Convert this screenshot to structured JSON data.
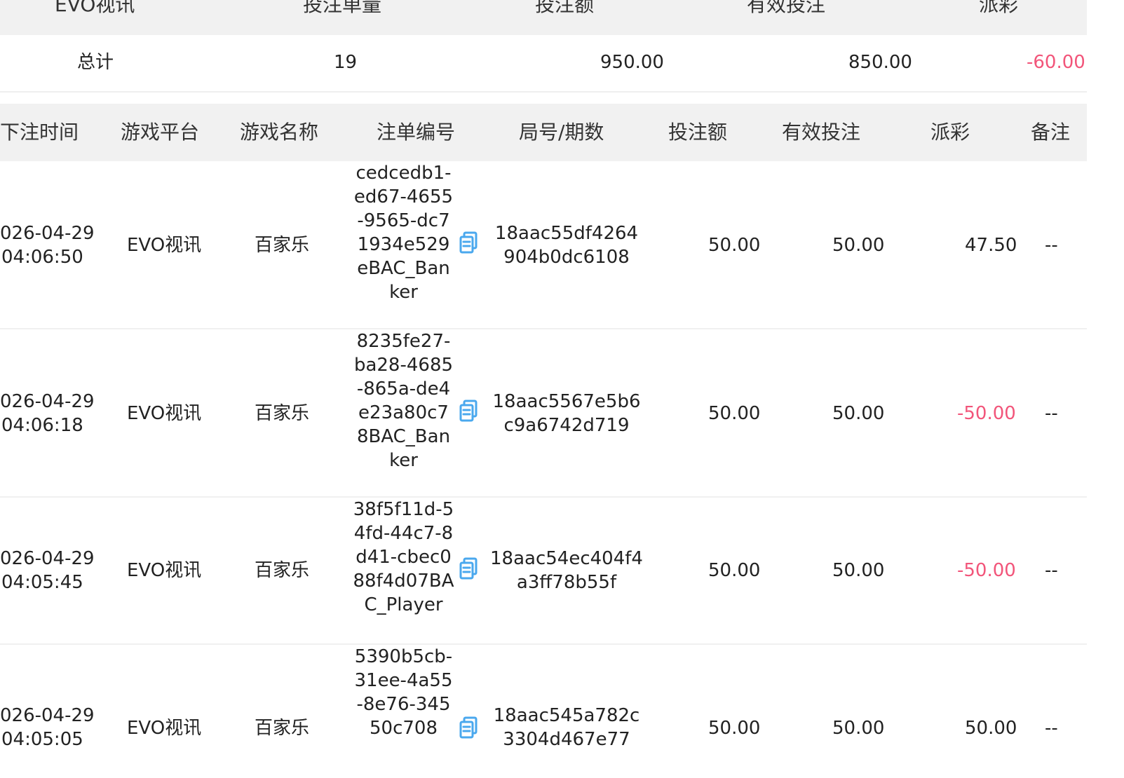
{
  "summary": {
    "headers": [
      "EVO视讯",
      "投注单量",
      "投注额",
      "有效投注",
      "派彩"
    ],
    "row": {
      "label": "总计",
      "bet_count": "19",
      "bet_amount": "950.00",
      "valid_bet": "850.00",
      "payout": "-60.00"
    }
  },
  "detail": {
    "headers": [
      "下注时间",
      "游戏平台",
      "游戏名称",
      "注单编号",
      "局号/期数",
      "投注额",
      "有效投注",
      "派彩",
      "备注"
    ],
    "rows": [
      {
        "date": "026-04-29",
        "time": "04:06:50",
        "platform": "EVO视讯",
        "game": "百家乐",
        "order_id": "cedcedb1-ed67-4655-9565-dc71934e529eBAC_Banker",
        "round_id": "18aac55df4264904b0dc6108",
        "bet_amount": "50.00",
        "valid_bet": "50.00",
        "payout": "47.50",
        "remark": "--"
      },
      {
        "date": "026-04-29",
        "time": "04:06:18",
        "platform": "EVO视讯",
        "game": "百家乐",
        "order_id": "8235fe27-ba28-4685-865a-de4e23a80c78BAC_Banker",
        "round_id": "18aac5567e5b6c9a6742d719",
        "bet_amount": "50.00",
        "valid_bet": "50.00",
        "payout": "-50.00",
        "remark": "--"
      },
      {
        "date": "026-04-29",
        "time": "04:05:45",
        "platform": "EVO视讯",
        "game": "百家乐",
        "order_id": "38f5f11d-54fd-44c7-8d41-cbec088f4d07BAC_Player",
        "round_id": "18aac54ec404f4a3ff78b55f",
        "bet_amount": "50.00",
        "valid_bet": "50.00",
        "payout": "-50.00",
        "remark": "--"
      },
      {
        "date": "026-04-29",
        "time": "04:05:05",
        "platform": "EVO视讯",
        "game": "百家乐",
        "order_id": "5390b5cb-31ee-4a55-8e76-34550c708",
        "round_id": "18aac545a782c3304d467e77",
        "bet_amount": "50.00",
        "valid_bet": "50.00",
        "payout": "50.00",
        "remark": "--"
      }
    ]
  },
  "colors": {
    "negative": "#f2557a",
    "header_bg": "#f1f1f1",
    "copy_icon": "#4aa8ee"
  },
  "icons": {
    "copy": "copy-icon"
  }
}
